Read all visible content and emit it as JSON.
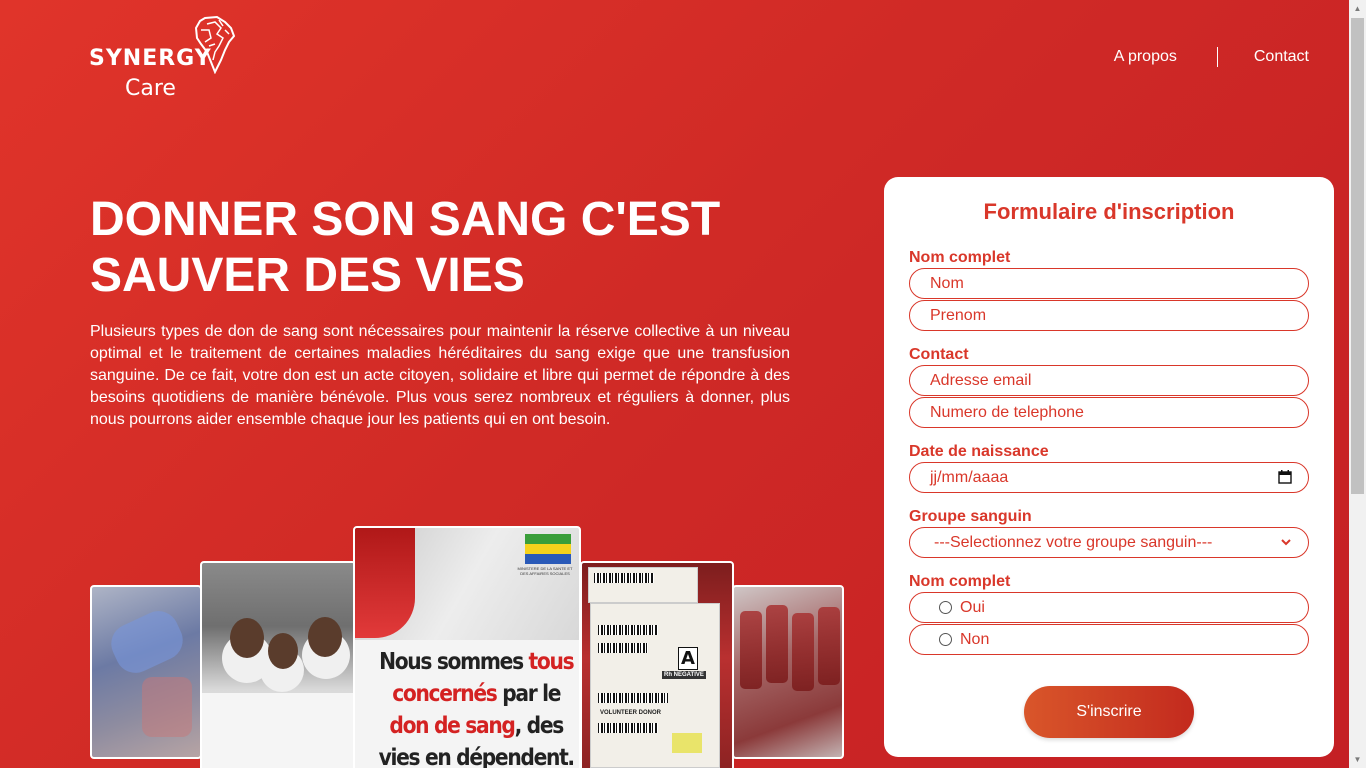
{
  "brand": {
    "name": "SYNERGY",
    "sub": "Care"
  },
  "nav": {
    "about": "A propos",
    "contact": "Contact"
  },
  "hero": {
    "title": "DONNER SON SANG C'EST SAUVER DES VIES",
    "text": "Plusieurs types de don de sang sont nécessaires pour maintenir la réserve collective à un niveau optimal et le traitement de certaines maladies héréditaires du sang exige que une transfusion sanguine. De ce fait, votre don est un acte citoyen, solidaire et libre qui permet de répondre à des besoins quotidiens de manière bénévole. Plus vous serez nombreux et réguliers à donner, plus nous pourrons aider ensemble chaque jour les patients qui en ont besoin."
  },
  "gallery": {
    "poster": {
      "ministry": "MINISTERE DE LA SANTE ET DES AFFAIRES SOCIALES",
      "line1a": "Nous sommes ",
      "line1b": "tous",
      "line2a": "concernés",
      "line2b": " par le",
      "line3a": "don de sang",
      "line3b": ", des",
      "line4": "vies en dépendent."
    },
    "bag": {
      "letter": "A",
      "rh": "Rh NEGATIVE",
      "label": "VOLUNTEER DONOR"
    }
  },
  "form": {
    "title": "Formulaire d'inscription",
    "name_label": "Nom complet",
    "name_placeholder": "Nom",
    "firstname_placeholder": "Prenom",
    "contact_label": "Contact",
    "email_placeholder": "Adresse email",
    "phone_placeholder": "Numero de telephone",
    "dob_label": "Date de naissance",
    "dob_placeholder": "jj/mm/aaaa",
    "blood_label": "Groupe sanguin",
    "blood_selected": "---Selectionnez votre groupe sanguin---",
    "radio_label": "Nom complet",
    "radio_yes": "Oui",
    "radio_no": "Non",
    "submit": "S'inscrire"
  },
  "colors": {
    "primary": "#d9372a",
    "background": "#d02a26",
    "card": "#ffffff"
  },
  "icons": [
    "africa-map-icon",
    "calendar-icon",
    "chevron-down-icon",
    "radio-icon"
  ]
}
